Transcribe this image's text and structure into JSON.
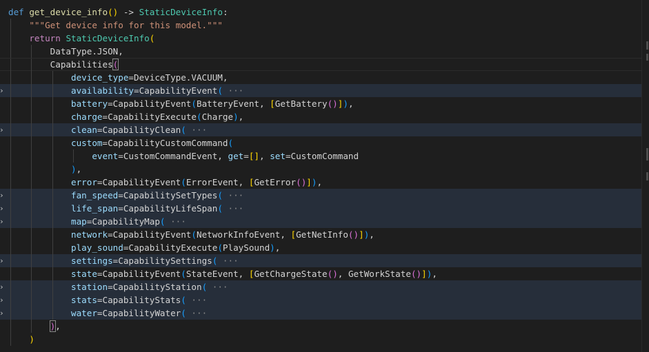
{
  "editor": {
    "language": "python",
    "lines": [
      {
        "tokens": [
          [
            "def",
            "kw"
          ],
          [
            " ",
            ""
          ],
          [
            "get_device_info",
            "fn"
          ],
          [
            "(",
            "p1"
          ],
          [
            ")",
            "p1"
          ],
          [
            " -> ",
            ""
          ],
          [
            "StaticDeviceInfo",
            "cls"
          ],
          [
            ":",
            ""
          ]
        ]
      },
      {
        "tokens": [
          [
            "    ",
            ""
          ],
          [
            "\"\"\"Get device info for this model.\"\"\"",
            "str"
          ]
        ]
      },
      {
        "tokens": [
          [
            "    ",
            ""
          ],
          [
            "return",
            "ret"
          ],
          [
            " ",
            ""
          ],
          [
            "StaticDeviceInfo",
            "cls"
          ],
          [
            "(",
            "p1"
          ]
        ]
      },
      {
        "tokens": [
          [
            "        ",
            ""
          ],
          [
            "DataType",
            "op"
          ],
          [
            ".JSON,",
            ""
          ]
        ]
      },
      {
        "tokens": [
          [
            "        ",
            ""
          ],
          [
            "Capabilities",
            "op"
          ],
          [
            "(",
            "p2 match"
          ]
        ],
        "current": true
      },
      {
        "tokens": [
          [
            "            ",
            ""
          ],
          [
            "device_type",
            "par"
          ],
          [
            "=DeviceType.VACUUM,",
            ""
          ]
        ]
      },
      {
        "tokens": [
          [
            "            ",
            ""
          ],
          [
            "availability",
            "par"
          ],
          [
            "=CapabilityEvent",
            ""
          ],
          [
            "(",
            "p3"
          ],
          [
            " ···",
            "ellipsis"
          ]
        ],
        "folded": true
      },
      {
        "tokens": [
          [
            "            ",
            ""
          ],
          [
            "battery",
            "par"
          ],
          [
            "=CapabilityEvent",
            ""
          ],
          [
            "(",
            "p3"
          ],
          [
            "BatteryEvent, ",
            ""
          ],
          [
            "[",
            "p1"
          ],
          [
            "GetBattery",
            ""
          ],
          [
            "(",
            "p2"
          ],
          [
            ")",
            "p2"
          ],
          [
            "]",
            "p1"
          ],
          [
            ")",
            "p3"
          ],
          [
            ",",
            ""
          ]
        ]
      },
      {
        "tokens": [
          [
            "            ",
            ""
          ],
          [
            "charge",
            "par"
          ],
          [
            "=CapabilityExecute",
            ""
          ],
          [
            "(",
            "p3"
          ],
          [
            "Charge",
            ""
          ],
          [
            ")",
            "p3"
          ],
          [
            ",",
            ""
          ]
        ]
      },
      {
        "tokens": [
          [
            "            ",
            ""
          ],
          [
            "clean",
            "par"
          ],
          [
            "=CapabilityClean",
            ""
          ],
          [
            "(",
            "p3"
          ],
          [
            " ···",
            "ellipsis"
          ]
        ],
        "folded": true
      },
      {
        "tokens": [
          [
            "            ",
            ""
          ],
          [
            "custom",
            "par"
          ],
          [
            "=CapabilityCustomCommand",
            ""
          ],
          [
            "(",
            "p3"
          ]
        ]
      },
      {
        "tokens": [
          [
            "                ",
            ""
          ],
          [
            "event",
            "par"
          ],
          [
            "=CustomCommandEvent, ",
            ""
          ],
          [
            "get",
            "par"
          ],
          [
            "=",
            ""
          ],
          [
            "[",
            "p1"
          ],
          [
            "]",
            "p1"
          ],
          [
            ", ",
            ""
          ],
          [
            "set",
            "par"
          ],
          [
            "=CustomCommand",
            ""
          ]
        ]
      },
      {
        "tokens": [
          [
            "            ",
            ""
          ],
          [
            ")",
            "p3"
          ],
          [
            ",",
            ""
          ]
        ]
      },
      {
        "tokens": [
          [
            "            ",
            ""
          ],
          [
            "error",
            "par"
          ],
          [
            "=CapabilityEvent",
            ""
          ],
          [
            "(",
            "p3"
          ],
          [
            "ErrorEvent, ",
            ""
          ],
          [
            "[",
            "p1"
          ],
          [
            "GetError",
            ""
          ],
          [
            "(",
            "p2"
          ],
          [
            ")",
            "p2"
          ],
          [
            "]",
            "p1"
          ],
          [
            ")",
            "p3"
          ],
          [
            ",",
            ""
          ]
        ]
      },
      {
        "tokens": [
          [
            "            ",
            ""
          ],
          [
            "fan_speed",
            "par"
          ],
          [
            "=CapabilitySetTypes",
            ""
          ],
          [
            "(",
            "p3"
          ],
          [
            " ···",
            "ellipsis"
          ]
        ],
        "folded": true
      },
      {
        "tokens": [
          [
            "            ",
            ""
          ],
          [
            "life_span",
            "par"
          ],
          [
            "=CapabilityLifeSpan",
            ""
          ],
          [
            "(",
            "p3"
          ],
          [
            " ···",
            "ellipsis"
          ]
        ],
        "folded": true
      },
      {
        "tokens": [
          [
            "            ",
            ""
          ],
          [
            "map",
            "par"
          ],
          [
            "=CapabilityMap",
            ""
          ],
          [
            "(",
            "p3"
          ],
          [
            " ···",
            "ellipsis"
          ]
        ],
        "folded": true
      },
      {
        "tokens": [
          [
            "            ",
            ""
          ],
          [
            "network",
            "par"
          ],
          [
            "=CapabilityEvent",
            ""
          ],
          [
            "(",
            "p3"
          ],
          [
            "NetworkInfoEvent, ",
            ""
          ],
          [
            "[",
            "p1"
          ],
          [
            "GetNetInfo",
            ""
          ],
          [
            "(",
            "p2"
          ],
          [
            ")",
            "p2"
          ],
          [
            "]",
            "p1"
          ],
          [
            ")",
            "p3"
          ],
          [
            ",",
            ""
          ]
        ]
      },
      {
        "tokens": [
          [
            "            ",
            ""
          ],
          [
            "play_sound",
            "par"
          ],
          [
            "=CapabilityExecute",
            ""
          ],
          [
            "(",
            "p3"
          ],
          [
            "PlaySound",
            ""
          ],
          [
            ")",
            "p3"
          ],
          [
            ",",
            ""
          ]
        ]
      },
      {
        "tokens": [
          [
            "            ",
            ""
          ],
          [
            "settings",
            "par"
          ],
          [
            "=CapabilitySettings",
            ""
          ],
          [
            "(",
            "p3"
          ],
          [
            " ···",
            "ellipsis"
          ]
        ],
        "folded": true
      },
      {
        "tokens": [
          [
            "            ",
            ""
          ],
          [
            "state",
            "par"
          ],
          [
            "=CapabilityEvent",
            ""
          ],
          [
            "(",
            "p3"
          ],
          [
            "StateEvent, ",
            ""
          ],
          [
            "[",
            "p1"
          ],
          [
            "GetChargeState",
            ""
          ],
          [
            "(",
            "p2"
          ],
          [
            ")",
            "p2"
          ],
          [
            ", GetWorkState",
            ""
          ],
          [
            "(",
            "p2"
          ],
          [
            ")",
            "p2"
          ],
          [
            "]",
            "p1"
          ],
          [
            ")",
            "p3"
          ],
          [
            ",",
            ""
          ]
        ]
      },
      {
        "tokens": [
          [
            "            ",
            ""
          ],
          [
            "station",
            "par"
          ],
          [
            "=CapabilityStation",
            ""
          ],
          [
            "(",
            "p3"
          ],
          [
            " ···",
            "ellipsis"
          ]
        ],
        "folded": true
      },
      {
        "tokens": [
          [
            "            ",
            ""
          ],
          [
            "stats",
            "par"
          ],
          [
            "=CapabilityStats",
            ""
          ],
          [
            "(",
            "p3"
          ],
          [
            " ···",
            "ellipsis"
          ]
        ],
        "folded": true
      },
      {
        "tokens": [
          [
            "            ",
            ""
          ],
          [
            "water",
            "par"
          ],
          [
            "=CapabilityWater",
            ""
          ],
          [
            "(",
            "p3"
          ],
          [
            " ···",
            "ellipsis"
          ]
        ],
        "folded": true
      },
      {
        "tokens": [
          [
            "        ",
            ""
          ],
          [
            ")",
            "p2 match"
          ],
          [
            ",",
            ""
          ]
        ]
      },
      {
        "tokens": [
          [
            "    ",
            ""
          ],
          [
            ")",
            "p1"
          ]
        ]
      }
    ]
  },
  "icons": {
    "fold": "chevron-right-icon"
  }
}
